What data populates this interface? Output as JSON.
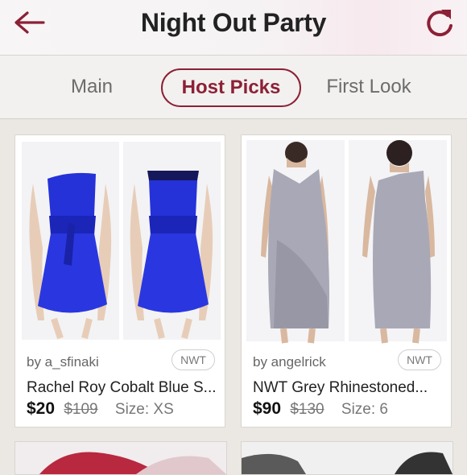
{
  "header": {
    "title": "Night Out Party"
  },
  "tabs": [
    {
      "label": "Main"
    },
    {
      "label": "Host Picks",
      "active": true
    },
    {
      "label": "First Look"
    }
  ],
  "listings": [
    {
      "seller": "by a_sfinaki",
      "badge": "NWT",
      "title": "Rachel Roy Cobalt Blue S...",
      "price": "$20",
      "original_price": "$109",
      "size": "Size: XS",
      "dress_color": "#2532d8"
    },
    {
      "seller": "by angelrick",
      "badge": "NWT",
      "title": "NWT Grey Rhinestoned...",
      "price": "$90",
      "original_price": "$130",
      "size": "Size: 6",
      "dress_color": "#a9a8b6"
    }
  ],
  "colors": {
    "accent": "#8c2036",
    "background": "#ebe7e2"
  },
  "icons": {
    "back": "arrow-left-icon",
    "refresh": "refresh-icon"
  }
}
